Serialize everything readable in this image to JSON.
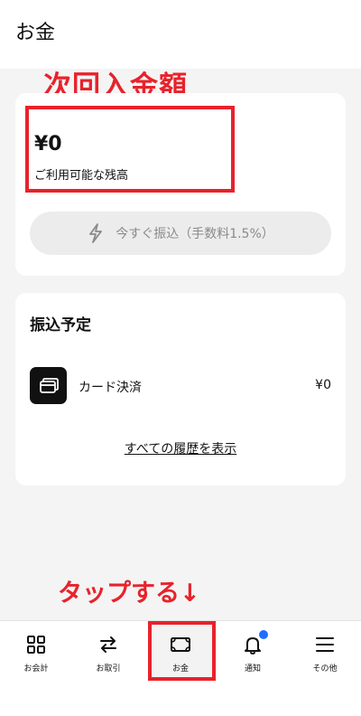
{
  "header": {
    "title": "お金"
  },
  "annotations": {
    "heading": "次回入金額",
    "tap_hint": "タップする↓"
  },
  "balance": {
    "amount": "¥0",
    "label": "ご利用可能な残高",
    "transfer_button": "今すぐ振込（手数料1.5%）"
  },
  "schedule": {
    "title": "振込予定",
    "items": [
      {
        "icon": "card-icon",
        "label": "カード決済",
        "amount": "¥0"
      }
    ],
    "history_link": "すべての履歴を表示"
  },
  "tabbar": {
    "items": [
      {
        "label": "お会計",
        "icon": "grid-icon"
      },
      {
        "label": "お取引",
        "icon": "swap-icon"
      },
      {
        "label": "お金",
        "icon": "money-icon",
        "selected": true
      },
      {
        "label": "通知",
        "icon": "bell-icon",
        "badge": true
      },
      {
        "label": "その他",
        "icon": "menu-icon"
      }
    ]
  },
  "colors": {
    "annotation_red": "#e8222b",
    "notification_blue": "#1f6fff",
    "background": "#f4f4f4"
  }
}
